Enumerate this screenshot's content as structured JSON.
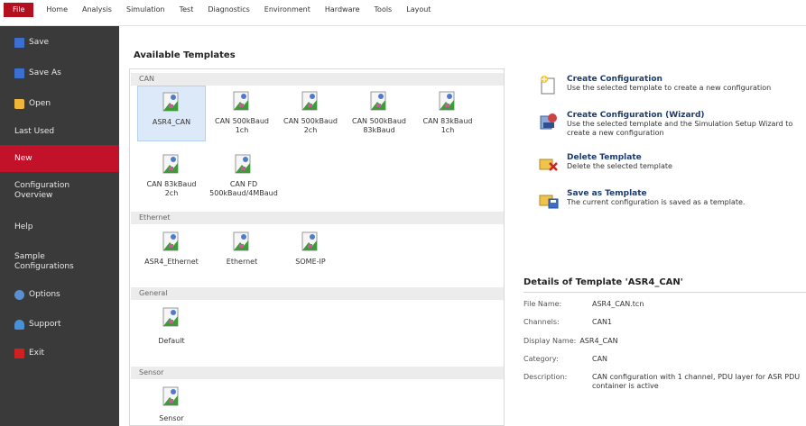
{
  "ribbon": {
    "tabs": [
      "File",
      "Home",
      "Analysis",
      "Simulation",
      "Test",
      "Diagnostics",
      "Environment",
      "Hardware",
      "Tools",
      "Layout"
    ]
  },
  "sidebar": {
    "items": [
      {
        "label": "Save",
        "icon": "save-icon",
        "color": "#3b6fd0"
      },
      {
        "label": "Save As",
        "icon": "save-as-icon",
        "color": "#3b6fd0"
      },
      {
        "label": "Open",
        "icon": "folder-icon",
        "color": "#f0b63a"
      },
      {
        "label": "Last Used",
        "icon": ""
      },
      {
        "label": "New",
        "icon": "",
        "active": true
      },
      {
        "label": "Configuration\nOverview",
        "icon": ""
      },
      {
        "label": "Help",
        "icon": ""
      },
      {
        "label": "Sample\nConfigurations",
        "icon": ""
      },
      {
        "label": "Options",
        "icon": "options-icon",
        "color": "#5a8fd0"
      },
      {
        "label": "Support",
        "icon": "support-icon",
        "color": "#4a90d6"
      },
      {
        "label": "Exit",
        "icon": "exit-icon",
        "color": "#d02020"
      }
    ]
  },
  "main": {
    "title": "Available Templates",
    "groups": [
      {
        "name": "CAN",
        "templates": [
          "ASR4_CAN",
          "CAN 500kBaud\n1ch",
          "CAN 500kBaud\n2ch",
          "CAN 500kBaud\n83kBaud",
          "CAN 83kBaud 1ch",
          "CAN 83kBaud 2ch",
          "CAN FD\n500kBaud/4MBaud"
        ]
      },
      {
        "name": "Ethernet",
        "templates": [
          "ASR4_Ethernet",
          "Ethernet",
          "SOME-IP"
        ]
      },
      {
        "name": "General",
        "templates": [
          "Default"
        ]
      },
      {
        "name": "Sensor",
        "templates": [
          "Sensor"
        ]
      }
    ],
    "selected_template": "ASR4_CAN"
  },
  "actions": [
    {
      "title": "Create Configuration",
      "desc": "Use the selected template to create a new configuration",
      "icon": "create-configuration-icon"
    },
    {
      "title": "Create Configuration (Wizard)",
      "desc": "Use the selected template and the Simulation Setup Wizard to create a new configuration",
      "icon": "wizard-icon"
    },
    {
      "title": "Delete Template",
      "desc": "Delete the selected template",
      "icon": "delete-template-icon"
    },
    {
      "title": "Save as Template",
      "desc": "The current configuration is saved as a template.",
      "icon": "save-template-icon"
    }
  ],
  "details": {
    "title": "Details of Template 'ASR4_CAN'",
    "file_name_label": "File Name:",
    "file_name": "ASR4_CAN.tcn",
    "channels_label": "Channels:",
    "channels": "CAN1",
    "display_name_label": "Display Name:",
    "display_name": "ASR4_CAN",
    "category_label": "Category:",
    "category": "CAN",
    "description_label": "Description:",
    "description": "CAN configuration with 1 channel, PDU layer for ASR PDU container is active"
  },
  "colors": {
    "accent": "#c1122a",
    "sidebar_bg": "#3a3a3a",
    "selected_bg": "#dce9f8",
    "action_title": "#1d3b6e"
  }
}
